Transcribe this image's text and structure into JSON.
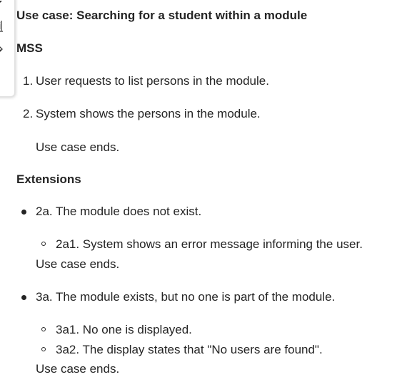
{
  "toolbar": {
    "icons": [
      "text-recognition-icon",
      "highlighter-icon",
      "more-icon"
    ],
    "more_label": "···"
  },
  "document": {
    "title": "Use case: Searching for a student within a module",
    "mss_heading": "MSS",
    "mss_steps": [
      {
        "number": "1.",
        "text": "User requests to list persons in the module."
      },
      {
        "number": "2.",
        "text": "System shows the persons in the module."
      }
    ],
    "mss_end": "Use case ends.",
    "extensions_heading": "Extensions",
    "ext_2a": "2a. The module does not exist.",
    "ext_2a1": "2a1. System shows an error message informing the user.",
    "ext_2a_end": "Use case ends.",
    "ext_3a": "3a. The module exists, but no one is part of the module.",
    "ext_3a1": "3a1. No one is displayed.",
    "ext_3a2": "3a2. The display states that \"No users are found\".",
    "ext_3a_end": "Use case ends."
  }
}
